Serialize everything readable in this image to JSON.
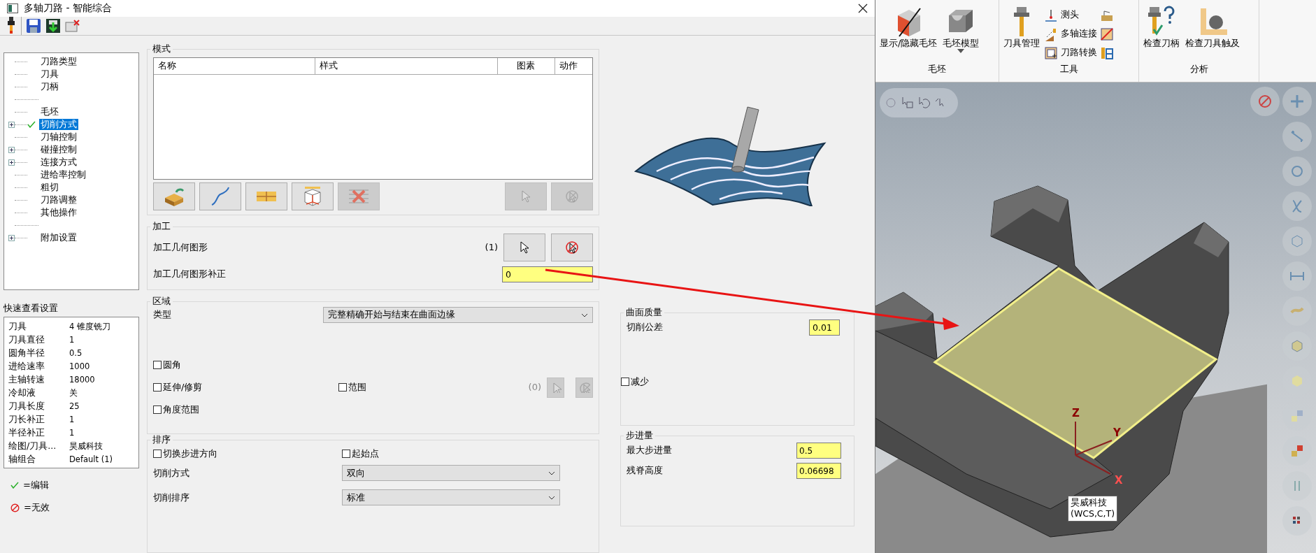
{
  "window": {
    "title": "多轴刀路 - 智能综合"
  },
  "tree": [
    {
      "kind": "node",
      "label": "刀路类型",
      "selected": false,
      "edited": false
    },
    {
      "kind": "node",
      "label": "刀具",
      "selected": false,
      "edited": false
    },
    {
      "kind": "node",
      "label": "刀柄",
      "selected": false,
      "edited": false
    },
    {
      "kind": "blank"
    },
    {
      "kind": "node",
      "label": "毛坯",
      "selected": false,
      "edited": false
    },
    {
      "kind": "node",
      "label": "切削方式",
      "selected": true,
      "edited": true,
      "expanded": false
    },
    {
      "kind": "node",
      "label": "刀轴控制",
      "selected": false,
      "edited": false
    },
    {
      "kind": "node",
      "label": "碰撞控制",
      "selected": false,
      "edited": false,
      "expanded": false
    },
    {
      "kind": "node",
      "label": "连接方式",
      "selected": false,
      "edited": false,
      "expanded": false
    },
    {
      "kind": "node",
      "label": "进给率控制",
      "selected": false,
      "edited": false
    },
    {
      "kind": "node",
      "label": "粗切",
      "selected": false,
      "edited": false
    },
    {
      "kind": "node",
      "label": "刀路调整",
      "selected": false,
      "edited": false
    },
    {
      "kind": "node",
      "label": "其他操作",
      "selected": false,
      "edited": false
    },
    {
      "kind": "blank"
    },
    {
      "kind": "node",
      "label": "附加设置",
      "selected": false,
      "edited": false,
      "expanded": false
    }
  ],
  "quick_view": {
    "title": "快速查看设置",
    "rows": [
      {
        "name": "刀具",
        "value": "4 锥度铣刀"
      },
      {
        "name": "刀具直径",
        "value": "1"
      },
      {
        "name": "圆角半径",
        "value": "0.5"
      },
      {
        "name": "进给速率",
        "value": "1000"
      },
      {
        "name": "主轴转速",
        "value": "18000"
      },
      {
        "name": "冷却液",
        "value": "关"
      },
      {
        "name": "刀具长度",
        "value": "25"
      },
      {
        "name": "刀长补正",
        "value": "1"
      },
      {
        "name": "半径补正",
        "value": "1"
      },
      {
        "name": "绘图/刀具...",
        "value": "昊威科技"
      },
      {
        "name": "轴组合",
        "value": "Default (1)"
      }
    ]
  },
  "legend": [
    {
      "kind": "edited",
      "label": "=编辑"
    },
    {
      "kind": "invalid",
      "label": "=无效"
    }
  ],
  "mode_group": {
    "title": "模式",
    "columns": [
      "名称",
      "样式",
      "图素",
      "动作"
    ],
    "tool_buttons": [
      {
        "kind": "insert",
        "disabled": false
      },
      {
        "kind": "curve",
        "disabled": false
      },
      {
        "kind": "layers",
        "disabled": false
      },
      {
        "kind": "box",
        "disabled": false
      },
      {
        "kind": "delete",
        "disabled": true
      }
    ],
    "pick_buttons": [
      {
        "kind": "select",
        "disabled": true
      },
      {
        "kind": "deselect",
        "disabled": true
      }
    ]
  },
  "machining": {
    "title": "加工",
    "geometry": {
      "label": "加工几何图形",
      "count": "(1)",
      "pick_buttons": [
        {
          "kind": "select",
          "disabled": false
        },
        {
          "kind": "deselect",
          "disabled": false
        }
      ]
    },
    "offset": {
      "label": "加工几何图形补正",
      "value": "0"
    }
  },
  "region": {
    "title": "区域",
    "type": {
      "label": "类型",
      "value": "完整精确开始与结束在曲面边缘"
    },
    "rows": [
      [
        {
          "label": "圆角",
          "checked": false
        }
      ],
      [
        {
          "label": "延伸/修剪",
          "checked": false
        },
        {
          "label": "范围",
          "checked": false,
          "count": "(0)",
          "pick_buttons": [
            {
              "kind": "select",
              "disabled": true
            },
            {
              "kind": "deselect",
              "disabled": true
            }
          ]
        }
      ],
      [
        {
          "label": "角度范围",
          "checked": false
        }
      ]
    ]
  },
  "sorting": {
    "title": "排序",
    "options": [
      {
        "label": "切换步进方向",
        "checked": false
      },
      {
        "label": "起始点",
        "checked": false
      }
    ],
    "selects": [
      {
        "label": "切削方式",
        "value": "双向"
      },
      {
        "label": "切削排序",
        "value": "标准"
      }
    ]
  },
  "surface_quality": {
    "title": "曲面质量",
    "tolerance": {
      "label": "切削公差",
      "value": "0.01"
    },
    "reduce": {
      "label": "减少",
      "checked": false
    }
  },
  "stepover": {
    "title": "步进量",
    "fields": [
      {
        "label": "最大步进量",
        "value": "0.5"
      },
      {
        "label": "残脊高度",
        "value": "0.06698"
      }
    ]
  },
  "ribbon": {
    "groups": [
      {
        "label": "毛坯",
        "large": [
          {
            "kind": "stock",
            "label": "显示/隐藏毛坯",
            "dropdown": false
          },
          {
            "kind": "stockmodel",
            "label": "毛坯模型",
            "dropdown": true
          }
        ]
      },
      {
        "label": "工具",
        "large": [
          {
            "kind": "toolmgr",
            "label": "刀具管理",
            "dropdown": false
          }
        ],
        "small": [
          {
            "kind": "probe",
            "label": "测头"
          },
          {
            "kind": "link",
            "label": "多轴连接"
          },
          {
            "kind": "convert",
            "label": "刀路转换"
          }
        ],
        "icons": [
          {
            "kind": "a"
          },
          {
            "kind": "b"
          },
          {
            "kind": "c"
          }
        ]
      },
      {
        "label": "分析",
        "large": [
          {
            "kind": "holder",
            "label": "检查刀柄",
            "dropdown": false
          },
          {
            "kind": "reach",
            "label": "检查刀具触及",
            "dropdown": false
          }
        ]
      }
    ]
  },
  "viewport": {
    "axis_labels": [
      {
        "kind": "z",
        "label": "Z"
      },
      {
        "kind": "y",
        "label": "Y"
      },
      {
        "kind": "x",
        "label": "X"
      }
    ],
    "tooltip": [
      "昊威科技",
      "(WCS,C,T)"
    ]
  }
}
